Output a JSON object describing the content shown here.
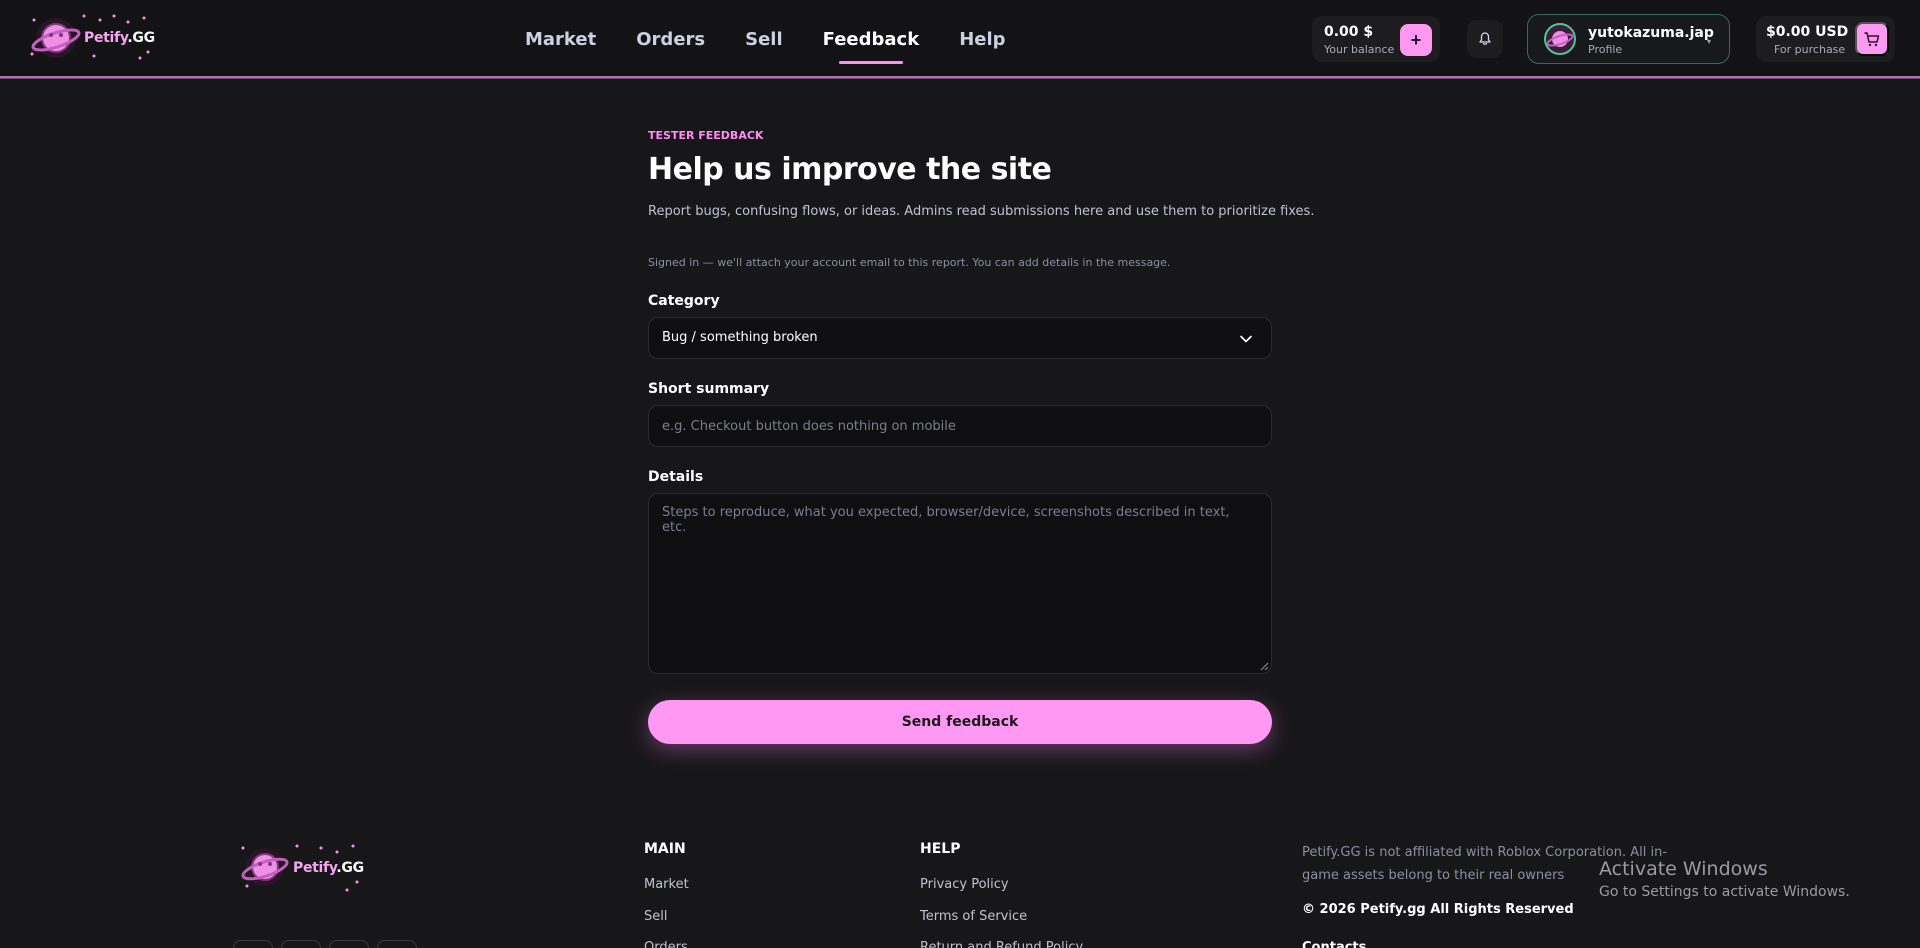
{
  "brand": {
    "name": "Petify",
    "suffix": ".GG",
    "accent": "#ff98f3",
    "background": "#171719"
  },
  "nav": {
    "items": [
      {
        "label": "Market"
      },
      {
        "label": "Orders"
      },
      {
        "label": "Sell"
      },
      {
        "label": "Feedback",
        "active": true
      },
      {
        "label": "Help"
      }
    ]
  },
  "balance": {
    "amount": "0.00 $",
    "label": "Your balance",
    "add_label": "+"
  },
  "profile": {
    "username": "yutokazuma.jap",
    "label": "Profile"
  },
  "cart": {
    "amount": "$0.00 USD",
    "label": "For purchase"
  },
  "feedback": {
    "eyebrow": "TESTER FEEDBACK",
    "title": "Help us improve the site",
    "description": "Report bugs, confusing flows, or ideas. Admins read submissions here and use them to prioritize fixes.",
    "signed_note": "Signed in — we'll attach your account email to this report. You can add details in the message.",
    "category_label": "Category",
    "category_value": "Bug / something broken",
    "summary_label": "Short summary",
    "summary_placeholder": "e.g. Checkout button does nothing on mobile",
    "details_label": "Details",
    "details_placeholder": "Steps to reproduce, what you expected, browser/device, screenshots described in text, etc.",
    "submit_label": "Send feedback"
  },
  "footer": {
    "main_heading": "MAIN",
    "main_links": [
      "Market",
      "Sell",
      "Orders"
    ],
    "help_heading": "HELP",
    "help_links": [
      "Privacy Policy",
      "Terms of Service",
      "Return and Refund Policy"
    ],
    "disclaimer": "Petify.GG is not affiliated with Roblox Corporation. All in-game assets belong to their real owners",
    "copyright": "© 2026 Petify.gg All Rights Reserved",
    "contacts_heading": "Contacts"
  },
  "os_watermark": {
    "line1": "Activate Windows",
    "line2": "Go to Settings to activate Windows."
  }
}
